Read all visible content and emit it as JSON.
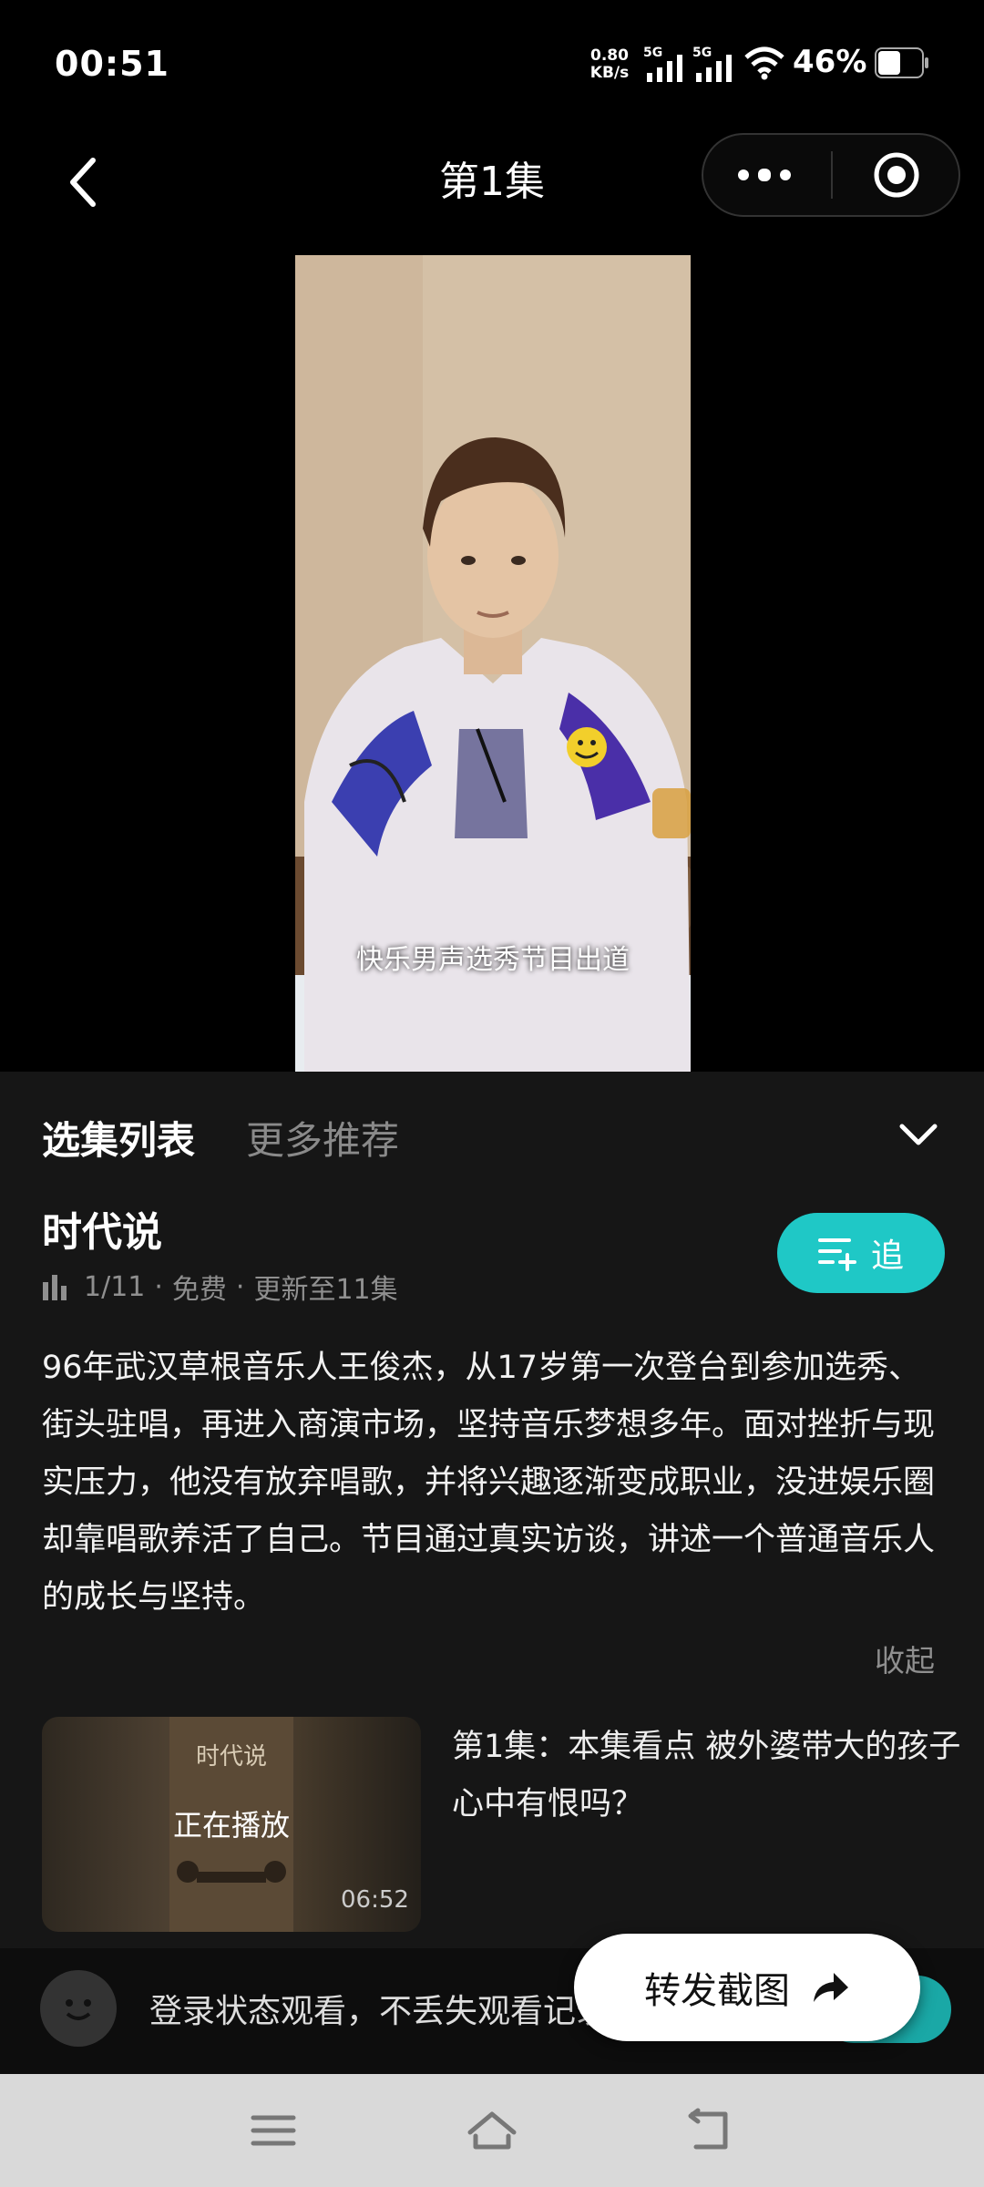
{
  "status_bar": {
    "time": "00:51",
    "net_speed_value": "0.80",
    "net_speed_unit": "KB/s",
    "signal1": "5G",
    "signal2": "5G",
    "battery": "46%"
  },
  "header": {
    "title": "第1集",
    "more_icon": "more-dots-icon",
    "close_icon": "target-circle-icon",
    "back_icon": "back-chevron-icon"
  },
  "video": {
    "subtitle": "快乐男声选秀节目出道"
  },
  "tabs": [
    {
      "label": "选集列表",
      "active": true
    },
    {
      "label": "更多推荐",
      "active": false
    }
  ],
  "show": {
    "title": "时代说",
    "progress": "1/11",
    "price": "免费",
    "update": "更新至11集",
    "separator": "·",
    "follow_label": "追",
    "description": "96年武汉草根音乐人王俊杰，从17岁第一次登台到参加选秀、街头驻唱，再进入商演市场，坚持音乐梦想多年。面对挫折与现实压力，他没有放弃唱歌，并将兴趣逐渐变成职业，没进娱乐圈却靠唱歌养活了自己。节目通过真实访谈，讲述一个普通音乐人的成长与坚持。",
    "collapse_label": "收起"
  },
  "episodes": [
    {
      "status": "正在播放",
      "duration": "06:52",
      "title": "第1集：本集看点 被外婆带大的孩子 心中有恨吗？",
      "thumb_text": "时代说"
    }
  ],
  "login_bar": {
    "text": "登录状态观看，不丢失观看记录"
  },
  "share_button": {
    "label": "转发截图"
  },
  "colors": {
    "accent": "#1fc8c6",
    "panel_bg": "#161616"
  }
}
